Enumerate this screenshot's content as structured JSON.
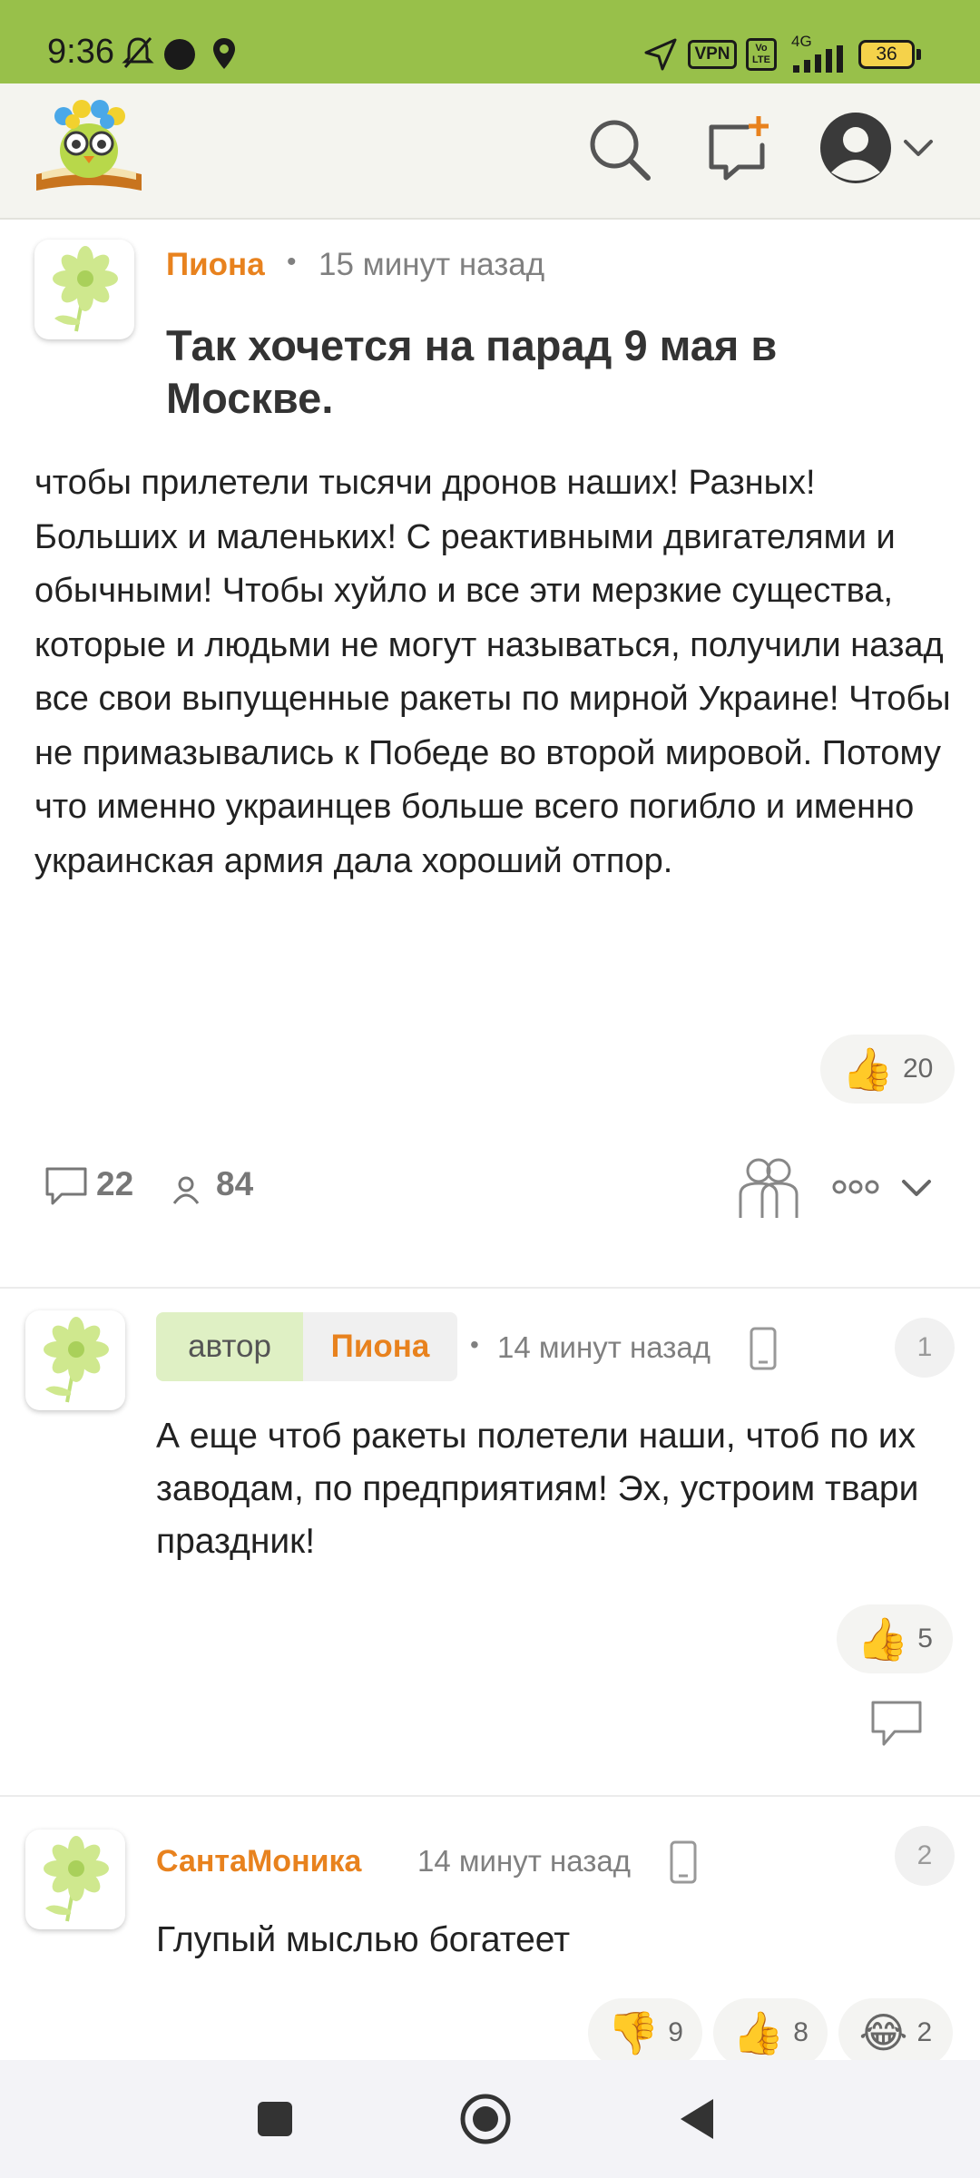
{
  "status_bar": {
    "time": "9:36",
    "vpn_badge": "VPN",
    "volte_badge": "Vo LTE",
    "network": "4G",
    "battery": "36"
  },
  "app_bar": {
    "logo_icon": "owl-on-book-logo",
    "search_icon": "search-icon",
    "new_post_icon": "new-post-icon",
    "profile_icon": "user-avatar-icon"
  },
  "post": {
    "author": "Пиона",
    "separator": "•",
    "time": "15 минут назад",
    "title": "Так хочется на парад 9 мая в Москве.",
    "body": "чтобы прилетели тысячи дронов наших! Разных! Больших и маленьких! С реактивными двигателями и обычными! Чтобы хуйло и все эти мерзкие существа, которые и людьми не могут называться, получили назад все свои выпущенные ракеты по мирной Украине! Чтобы не примазывались к Победе во второй мировой. Потому что именно украинцев больше всего погибло и именно украинская армия дала хороший отпор.",
    "likes": "20",
    "comments_count": "22",
    "participants_count": "84"
  },
  "comments": [
    {
      "author_badge": "автор",
      "author": "Пиона",
      "separator": "•",
      "time": "14 минут назад",
      "number": "1",
      "text": "А еще чтоб ракеты полетели наши, чтоб по их заводам, по предприятиям! Эх, устроим твари праздник!",
      "likes": "5"
    },
    {
      "author": "СантаМоника",
      "time": "14 минут назад",
      "number": "2",
      "text": "Глупый мыслью богатеет",
      "dislikes": "9",
      "likes": "8",
      "laughs": "2"
    }
  ],
  "colors": {
    "status_bar": "#98c04a",
    "accent": "#e8821e",
    "badge_bg": "#dff0c4"
  }
}
